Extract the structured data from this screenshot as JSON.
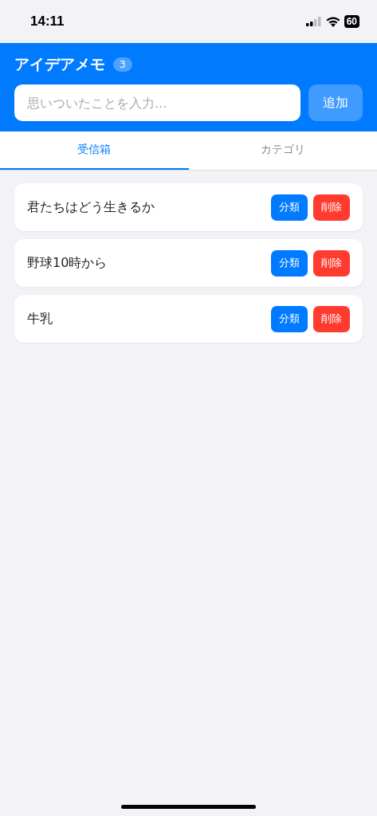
{
  "status_bar": {
    "time": "14:11",
    "battery": "60"
  },
  "header": {
    "title": "アイデアメモ",
    "count": "3",
    "input": {
      "placeholder": "思いついたことを入力..."
    },
    "add_button": "追加"
  },
  "tabs": [
    {
      "label": "受信箱",
      "selected": true
    },
    {
      "label": "カテゴリ",
      "selected": false
    }
  ],
  "items": [
    {
      "text": "君たちはどう生きるか",
      "classify": "分類",
      "delete": "削除"
    },
    {
      "text": "野球10時から",
      "classify": "分類",
      "delete": "削除"
    },
    {
      "text": "牛乳",
      "classify": "分類",
      "delete": "削除"
    }
  ]
}
